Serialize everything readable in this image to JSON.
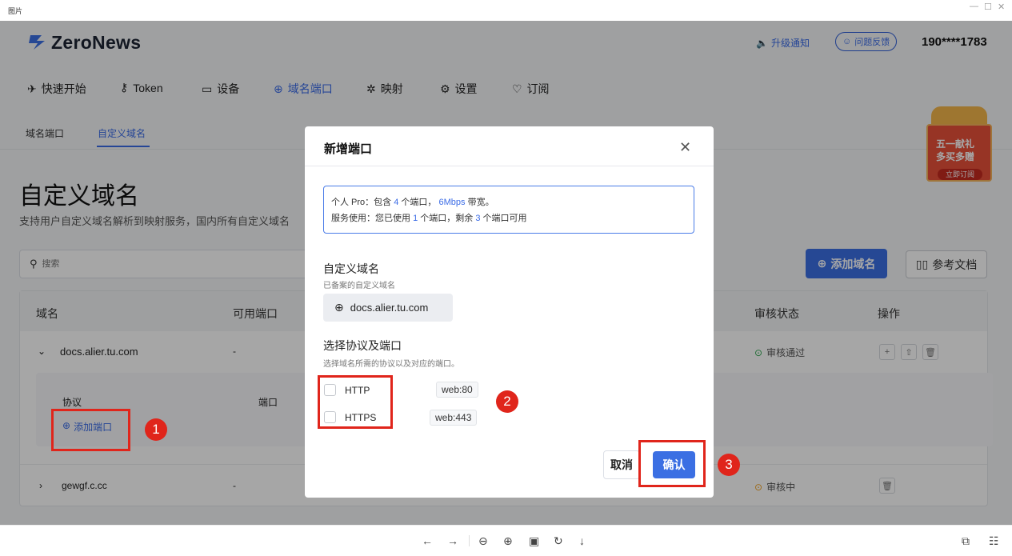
{
  "window": {
    "title": "图片"
  },
  "app": {
    "brand": "ZeroNews",
    "upgrade_notice": "升级通知",
    "feedback": "问题反馈",
    "user_phone": "190****1783"
  },
  "nav": [
    {
      "label": "快速开始",
      "icon": "rocket-icon"
    },
    {
      "label": "Token",
      "icon": "key-icon"
    },
    {
      "label": "设备",
      "icon": "monitor-icon"
    },
    {
      "label": "域名端口",
      "icon": "globe-icon",
      "active": true
    },
    {
      "label": "映射",
      "icon": "mapping-icon"
    },
    {
      "label": "设置",
      "icon": "gear-icon"
    },
    {
      "label": "订阅",
      "icon": "diamond-icon"
    }
  ],
  "subtabs": [
    {
      "label": "域名端口"
    },
    {
      "label": "自定义域名",
      "active": true
    }
  ],
  "promo": {
    "line1": "五一献礼",
    "line2": "多买多赠",
    "cta": "立即订阅"
  },
  "page": {
    "title": "自定义域名",
    "description": "支持用户自定义域名解析到映射服务，国内所有自定义域名",
    "search_placeholder": "搜索",
    "add_domain": "添加域名",
    "docs": "参考文档"
  },
  "table": {
    "headers": {
      "domain": "域名",
      "available_ports": "可用端口",
      "review_status": "审核状态",
      "actions": "操作"
    },
    "rows": [
      {
        "domain": "docs.alier.tu.com",
        "ports": "-",
        "status": "审核通过",
        "status_color": "#2fa74f"
      },
      {
        "domain": "gewgf.c.cc",
        "ports": "-",
        "status": "审核中",
        "status_color": "#f0a020"
      }
    ],
    "expanded": {
      "protocol_label": "协议",
      "port_label": "端口",
      "add_port": "添加端口"
    }
  },
  "modal": {
    "title": "新增端口",
    "info_line1": {
      "prefix": "个人 Pro：包含 ",
      "ports": "4",
      "mid": " 个端口，  ",
      "bandwidth": "6Mbps",
      "suffix": " 带宽。"
    },
    "info_line2": {
      "prefix": "服务使用：您已使用 ",
      "used": "1",
      "mid": " 个端口，剩余 ",
      "left": "3",
      "suffix": " 个端口可用"
    },
    "domain_label": "自定义域名",
    "domain_sub": "已备案的自定义域名",
    "domain_value": "docs.alier.tu.com",
    "proto_label": "选择协议及端口",
    "proto_sub": "选择域名所需的协议以及对应的端口。",
    "protocols": [
      {
        "name": "HTTP",
        "port": "web:80"
      },
      {
        "name": "HTTPS",
        "port": "web:443"
      }
    ],
    "cancel": "取消",
    "confirm": "确认"
  },
  "annotations": [
    "1",
    "2",
    "3"
  ],
  "colors": {
    "accent": "#3b6fe3",
    "annotation": "#e0251b"
  }
}
